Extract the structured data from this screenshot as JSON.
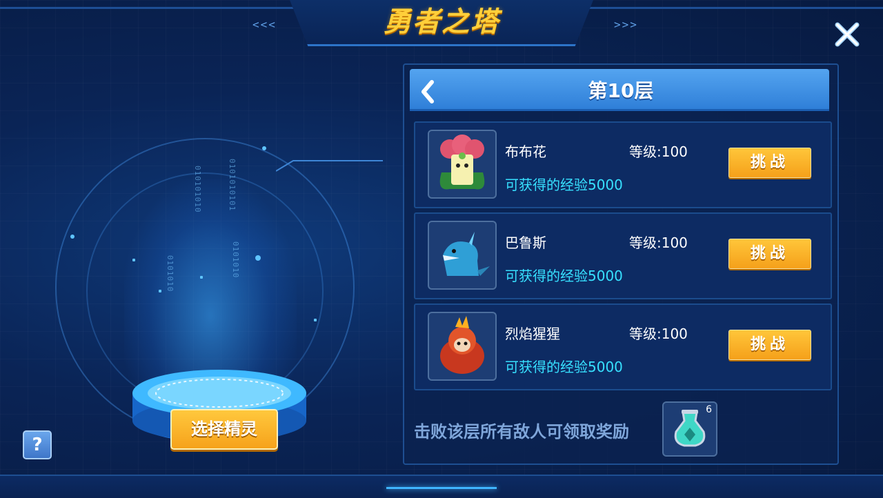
{
  "header": {
    "title": "勇者之塔",
    "left_chevrons": "<<<",
    "right_chevrons": ">>>"
  },
  "left": {
    "select_button": "选择精灵",
    "help_button": "?"
  },
  "panel": {
    "floor_title": "第10层",
    "enemies": [
      {
        "name": "布布花",
        "level": "等级:100",
        "exp": "可获得的经验5000",
        "challenge": "挑战"
      },
      {
        "name": "巴鲁斯",
        "level": "等级:100",
        "exp": "可获得的经验5000",
        "challenge": "挑战"
      },
      {
        "name": "烈焰猩猩",
        "level": "等级:100",
        "exp": "可获得的经验5000",
        "challenge": "挑战"
      }
    ],
    "reward_text": "击败该层所有敌人可领取奖励",
    "reward_count": "6"
  },
  "colors": {
    "accent_gold": "#ffc63a",
    "exp_cyan": "#37e0ff",
    "header_blue": "#3f8fe4"
  }
}
